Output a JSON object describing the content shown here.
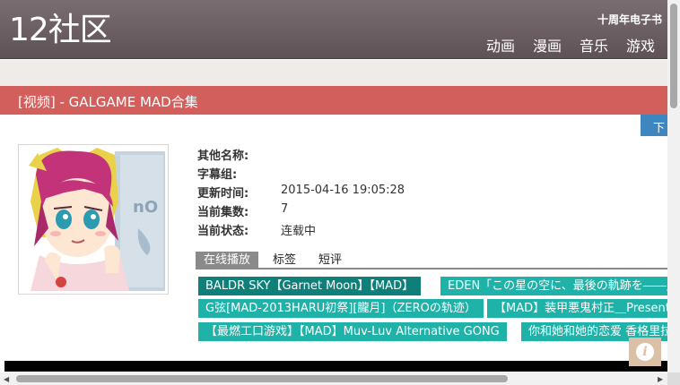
{
  "header": {
    "logo": "12社区",
    "tagline": "十周年电子书",
    "nav": [
      "动画",
      "漫画",
      "音乐",
      "游戏"
    ]
  },
  "title": "[视频] - GALGAME MAD合集",
  "download_button": "下",
  "details": [
    {
      "label": "其他名称:",
      "value": ""
    },
    {
      "label": "字幕组:",
      "value": ""
    },
    {
      "label": "更新时间:",
      "value": "2015-04-16 19:05:28"
    },
    {
      "label": "当前集数:",
      "value": "7"
    },
    {
      "label": "当前状态:",
      "value": "连载中"
    }
  ],
  "tabs": [
    "在线播放",
    "标签",
    "短评"
  ],
  "episodes": [
    "BALDR SKY【Garnet Moon】【MAD】",
    "EDEN「この星の空に、最後の軌跡を――」",
    "G弦[MAD-2013HARU初祭][朧月]（ZEROの轨迹）",
    "【MAD】装甲悪鬼村正＿Present",
    "【最燃工口游戏】【MAD】Muv-Luv Alternative GONG",
    "你和她和她的恋爱 香格里拉"
  ],
  "info_icon": "i",
  "colors": {
    "header": "#6d6065",
    "title_bar": "#d35f5c",
    "episode": "#1fb2a8",
    "episode_selected": "#0f7f7a",
    "download": "#3e86c0"
  }
}
